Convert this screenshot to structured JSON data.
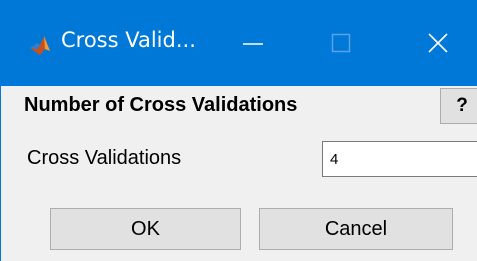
{
  "window": {
    "title": "Cross Valid...",
    "app_icon": "matlab-icon",
    "controls": {
      "minimize_icon": "minimize-icon",
      "maximize_icon": "maximize-icon",
      "close_icon": "close-icon"
    },
    "titlebar_color": "#0078d7"
  },
  "dialog": {
    "heading": "Number of Cross Validations",
    "help_label": "?",
    "field_label": "Cross Validations",
    "field_value": "4",
    "ok_label": "OK",
    "cancel_label": "Cancel"
  }
}
